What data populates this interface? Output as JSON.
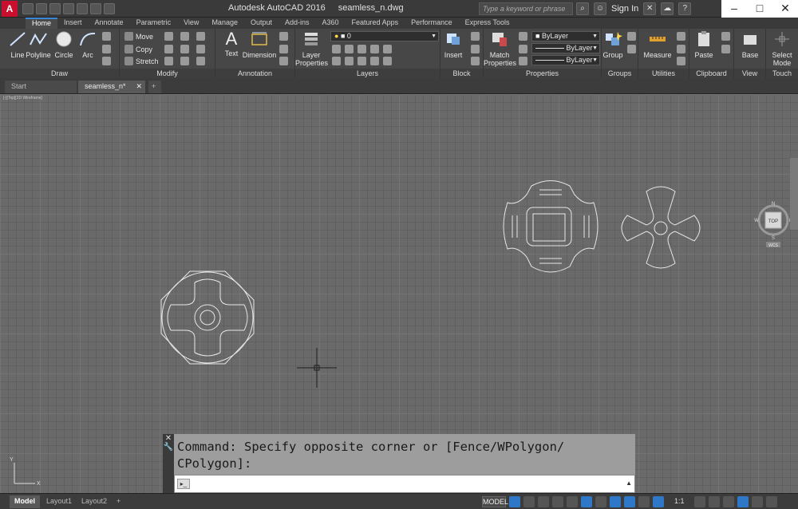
{
  "titlebar": {
    "app_name": "Autodesk AutoCAD 2016",
    "file_name": "seamless_n.dwg",
    "search_placeholder": "Type a keyword or phrase",
    "sign_in": "Sign In"
  },
  "tabs": [
    "Home",
    "Insert",
    "Annotate",
    "Parametric",
    "View",
    "Manage",
    "Output",
    "Add-ins",
    "A360",
    "Featured Apps",
    "Performance",
    "Express Tools"
  ],
  "ribbon": {
    "draw": {
      "title": "Draw",
      "line": "Line",
      "polyline": "Polyline",
      "circle": "Circle",
      "arc": "Arc"
    },
    "modify": {
      "title": "Modify",
      "move": "Move",
      "copy": "Copy",
      "stretch": "Stretch"
    },
    "annotation": {
      "title": "Annotation",
      "text": "Text",
      "dimension": "Dimension"
    },
    "layers": {
      "title": "Layers",
      "layer_properties_1": "Layer",
      "layer_properties_2": "Properties",
      "current_layer": "0"
    },
    "block": {
      "title": "Block",
      "insert": "Insert"
    },
    "properties": {
      "title": "Properties",
      "match_1": "Match",
      "match_2": "Properties",
      "color": "ByLayer",
      "linetype": "ByLayer",
      "lineweight": "ByLayer"
    },
    "groups": {
      "title": "Groups",
      "group": "Group"
    },
    "utilities": {
      "title": "Utilities",
      "measure": "Measure"
    },
    "clipboard": {
      "title": "Clipboard",
      "paste": "Paste"
    },
    "view": {
      "title": "View",
      "base": "Base"
    },
    "touch": {
      "title": "Touch",
      "select_1": "Select",
      "select_2": "Mode"
    }
  },
  "doc_tabs": {
    "start": "Start",
    "current": "seamless_n*"
  },
  "viewport": {
    "label": "[-][Top][2D Wireframe]",
    "viewcube_top": "TOP",
    "compass_n": "N",
    "compass_s": "S",
    "compass_e": "E",
    "compass_w": "W",
    "wcs": "WCS"
  },
  "command": {
    "history_line1": "Command: Specify opposite corner or [Fence/WPolygon/",
    "history_line2": "CPolygon]:"
  },
  "statusbar": {
    "model_tab": "Model",
    "layout1": "Layout1",
    "layout2": "Layout2",
    "model_button": "MODEL",
    "scale": "1:1"
  }
}
